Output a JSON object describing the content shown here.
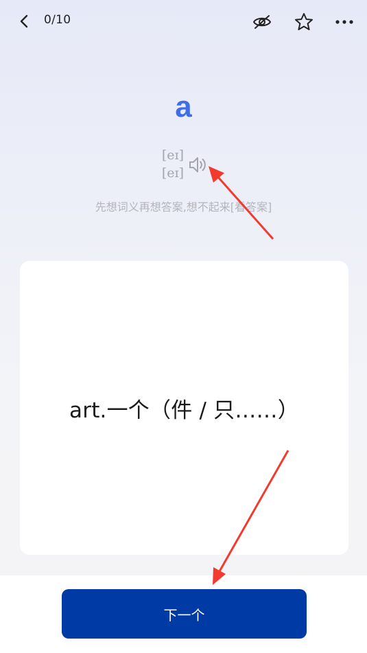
{
  "header": {
    "progress": "0/10"
  },
  "icons": {
    "back": "chevron-left-icon",
    "hide": "eye-off-icon",
    "favorite": "star-icon",
    "more": "more-horizontal-icon",
    "sound": "speaker-icon"
  },
  "word": {
    "text": "a",
    "phonetic_uk": "[eɪ]",
    "phonetic_us": "[eɪ]"
  },
  "hint": "先想词义再想答案,想不起来[看答案]",
  "card": {
    "meaning": "art.一个（件 / 只……）"
  },
  "footer": {
    "next_label": "下一个"
  },
  "colors": {
    "word": "#3f6fe8",
    "primary_button": "#003aa5",
    "annotation_arrow": "#f23a2e"
  }
}
